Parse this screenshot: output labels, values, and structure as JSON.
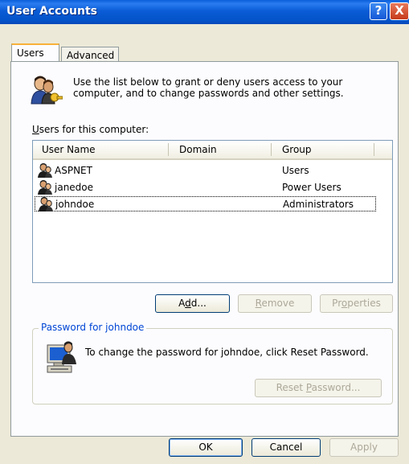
{
  "window": {
    "title": "User Accounts"
  },
  "titlebar_buttons": {
    "help": "?",
    "close": "X"
  },
  "tabs": [
    {
      "label": "Users"
    },
    {
      "label": "Advanced"
    }
  ],
  "intro_text": "Use the list below to grant or deny users access to your computer, and to change passwords and other settings.",
  "users_list": {
    "label_u": "U",
    "label_rest": "sers for this computer:",
    "columns": [
      "User Name",
      "Domain",
      "Group"
    ],
    "rows": [
      {
        "user": "ASPNET",
        "domain": "",
        "group": "Users"
      },
      {
        "user": "janedoe",
        "domain": "",
        "group": "Power Users"
      },
      {
        "user": "johndoe",
        "domain": "",
        "group": "Administrators"
      }
    ]
  },
  "buttons": {
    "add": {
      "pre": "A",
      "accel": "d",
      "post": "d..."
    },
    "remove": {
      "accel": "R",
      "post": "emove"
    },
    "properties": {
      "pre": "Pr",
      "accel": "o",
      "post": "perties"
    },
    "reset": {
      "pre": "Reset ",
      "accel": "P",
      "post": "assword..."
    },
    "ok": "OK",
    "cancel": "Cancel",
    "apply": "Apply"
  },
  "password_group": {
    "title": "Password for johndoe",
    "text": "To change the password for johndoe, click Reset Password."
  },
  "colors": {
    "titlebar": "#0a5cd6",
    "dialog_bg": "#ece9d8",
    "groupbox_label": "#0046d5",
    "tab_highlight": "#f7b13a"
  },
  "icons": {
    "users_keys": "users-keys-icon",
    "user": "user-icon",
    "computer_user": "computer-user-icon"
  }
}
